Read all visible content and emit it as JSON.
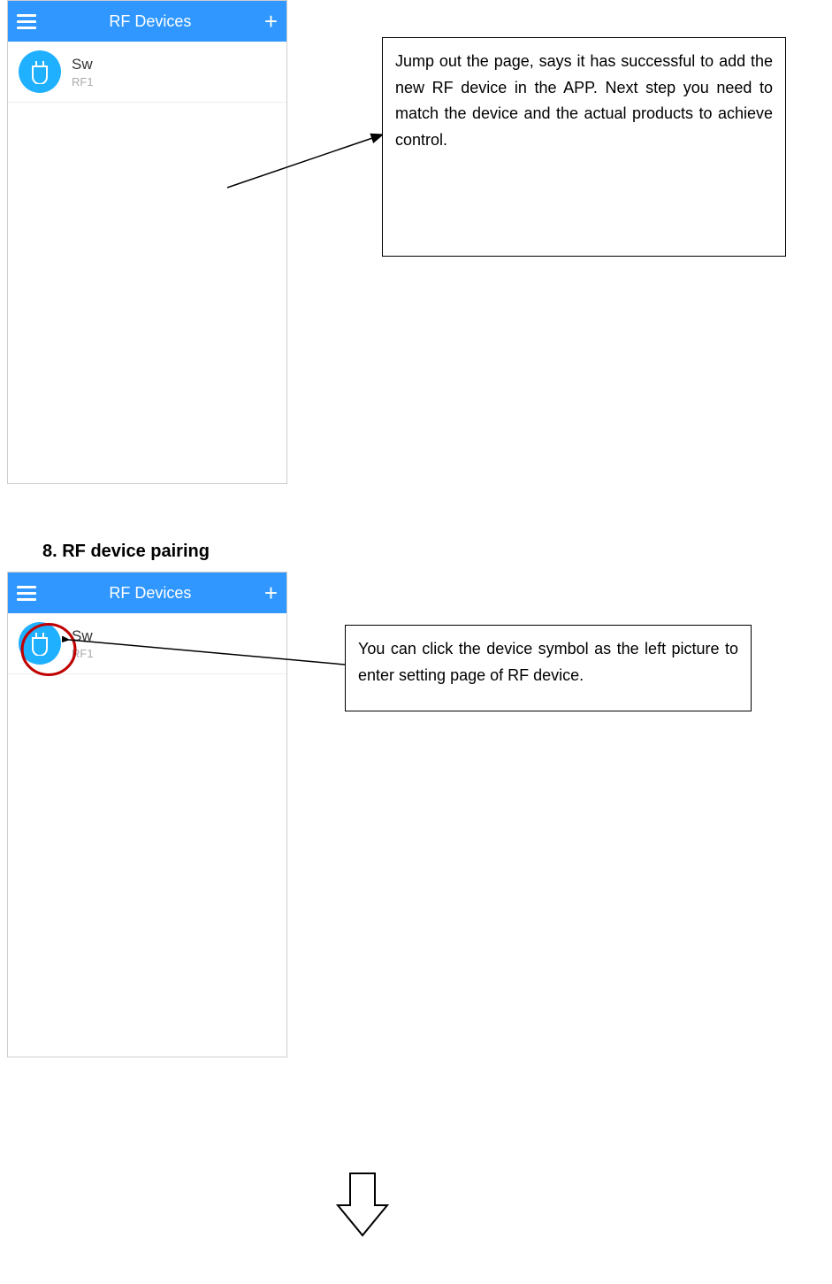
{
  "figure1": {
    "titlebar": "RF Devices",
    "device": {
      "name": "Sw",
      "sub": "RF1"
    }
  },
  "callout1": "Jump out the page, says it has successful to add the new RF device in the APP. Next step you need to match the device and the actual products to achieve control.",
  "heading": "8.  RF device pairing",
  "figure2": {
    "titlebar": "RF Devices",
    "device": {
      "name": "Sw",
      "sub": "RF1"
    }
  },
  "callout2": "You can click the device symbol as the left picture to enter setting page of RF device."
}
